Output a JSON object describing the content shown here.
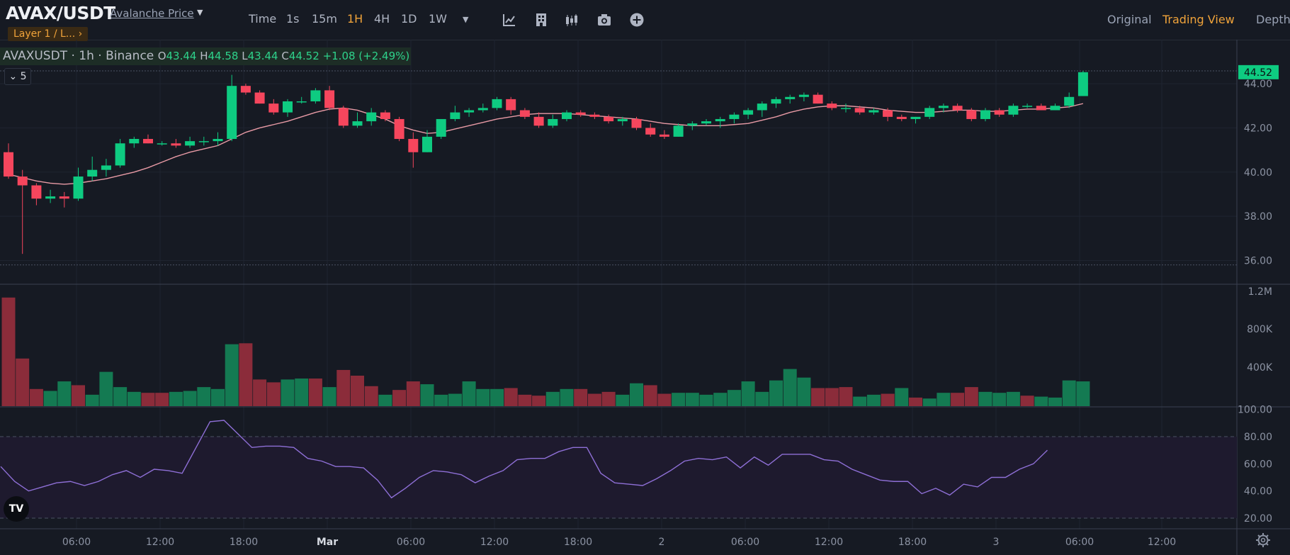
{
  "header": {
    "pair": "AVAX/USDT",
    "price_link": "Avalanche Price",
    "tag": "Layer 1 / L...",
    "tag_chevron": "›",
    "timeframes": [
      "Time",
      "1s",
      "15m",
      "1H",
      "4H",
      "1D",
      "1W"
    ],
    "active_timeframe": "1H",
    "tools": [
      "indicator-icon",
      "template-icon",
      "candle-style-icon",
      "camera-icon",
      "add-circle-icon"
    ],
    "views": [
      "Original",
      "Trading View",
      "Depth"
    ],
    "active_view": "Trading View"
  },
  "legend": {
    "symbol": "AVAXUSDT",
    "interval": "1h",
    "exchange": "Binance",
    "open_label": "O",
    "open": "43.44",
    "high_label": "H",
    "high": "44.58",
    "low_label": "L",
    "low": "43.44",
    "close_label": "C",
    "close": "44.52",
    "change": "+1.08 (+2.49%)",
    "indicator_count": "5"
  },
  "colors": {
    "up": "#0ecb81",
    "down": "#f6465d",
    "up_volume": "#147a52",
    "down_volume": "#8b2c3a",
    "rsi": "#8e6fd6",
    "ma": "#e89aa5",
    "accent": "#f0a33a"
  },
  "chart_data": {
    "type": "candlestick",
    "symbol": "AVAXUSDT",
    "last_price": "44.52",
    "price_axis": [
      "44.00",
      "42.00",
      "40.00",
      "38.00",
      "36.00"
    ],
    "volume_axis": [
      "1.2M",
      "800K",
      "400K"
    ],
    "rsi_axis": [
      "100.00",
      "80.00",
      "60.00",
      "40.00",
      "20.00"
    ],
    "time_axis": [
      "06:00",
      "12:00",
      "18:00",
      "Mar",
      "06:00",
      "12:00",
      "18:00",
      "2",
      "06:00",
      "12:00",
      "18:00",
      "3",
      "06:00",
      "12:00"
    ],
    "ylim": [
      35.6,
      44.9
    ],
    "candles": [
      [
        40.9,
        41.3,
        39.7,
        39.8
      ],
      [
        39.8,
        40.1,
        36.3,
        39.4
      ],
      [
        39.4,
        39.5,
        38.5,
        38.8
      ],
      [
        38.8,
        39.2,
        38.6,
        38.9
      ],
      [
        38.9,
        39.1,
        38.4,
        38.8
      ],
      [
        38.8,
        40.2,
        38.7,
        39.8
      ],
      [
        39.8,
        40.7,
        39.6,
        40.1
      ],
      [
        40.1,
        40.6,
        39.8,
        40.3
      ],
      [
        40.3,
        41.5,
        40.2,
        41.3
      ],
      [
        41.3,
        41.6,
        41.1,
        41.5
      ],
      [
        41.5,
        41.7,
        41.3,
        41.3
      ],
      [
        41.3,
        41.4,
        41.2,
        41.3
      ],
      [
        41.3,
        41.5,
        41.1,
        41.2
      ],
      [
        41.2,
        41.6,
        41.1,
        41.4
      ],
      [
        41.4,
        41.6,
        41.2,
        41.4
      ],
      [
        41.4,
        41.8,
        41.2,
        41.5
      ],
      [
        41.5,
        44.4,
        41.4,
        43.9
      ],
      [
        43.9,
        44.0,
        43.5,
        43.6
      ],
      [
        43.6,
        43.7,
        43.1,
        43.1
      ],
      [
        43.1,
        43.3,
        42.6,
        42.7
      ],
      [
        42.7,
        43.3,
        42.5,
        43.2
      ],
      [
        43.2,
        43.4,
        43.1,
        43.2
      ],
      [
        43.2,
        43.8,
        43.1,
        43.7
      ],
      [
        43.7,
        43.9,
        42.8,
        42.9
      ],
      [
        42.9,
        43.0,
        42.0,
        42.1
      ],
      [
        42.1,
        42.7,
        42.0,
        42.3
      ],
      [
        42.3,
        42.9,
        42.1,
        42.7
      ],
      [
        42.7,
        42.8,
        42.3,
        42.4
      ],
      [
        42.4,
        42.5,
        41.4,
        41.5
      ],
      [
        41.5,
        41.8,
        40.2,
        40.9
      ],
      [
        40.9,
        41.9,
        40.9,
        41.6
      ],
      [
        41.6,
        42.4,
        41.5,
        42.4
      ],
      [
        42.4,
        43.0,
        42.3,
        42.7
      ],
      [
        42.7,
        42.9,
        42.5,
        42.8
      ],
      [
        42.8,
        43.1,
        42.7,
        42.9
      ],
      [
        42.9,
        43.4,
        42.8,
        43.3
      ],
      [
        43.3,
        43.4,
        42.6,
        42.8
      ],
      [
        42.8,
        42.9,
        42.4,
        42.5
      ],
      [
        42.5,
        42.7,
        42.0,
        42.1
      ],
      [
        42.1,
        42.6,
        42.0,
        42.4
      ],
      [
        42.4,
        42.8,
        42.3,
        42.7
      ],
      [
        42.7,
        42.8,
        42.5,
        42.6
      ],
      [
        42.6,
        42.7,
        42.4,
        42.5
      ],
      [
        42.5,
        42.6,
        42.2,
        42.3
      ],
      [
        42.3,
        42.5,
        42.1,
        42.4
      ],
      [
        42.4,
        42.5,
        41.9,
        42.0
      ],
      [
        42.0,
        42.2,
        41.6,
        41.7
      ],
      [
        41.7,
        41.9,
        41.5,
        41.6
      ],
      [
        41.6,
        42.2,
        41.6,
        42.1
      ],
      [
        42.1,
        42.3,
        41.9,
        42.2
      ],
      [
        42.2,
        42.4,
        42.1,
        42.3
      ],
      [
        42.3,
        42.5,
        42.0,
        42.4
      ],
      [
        42.4,
        42.7,
        42.2,
        42.6
      ],
      [
        42.6,
        42.9,
        42.4,
        42.8
      ],
      [
        42.8,
        43.2,
        42.5,
        43.1
      ],
      [
        43.1,
        43.4,
        42.9,
        43.3
      ],
      [
        43.3,
        43.5,
        43.1,
        43.4
      ],
      [
        43.4,
        43.6,
        43.2,
        43.5
      ],
      [
        43.5,
        43.6,
        43.1,
        43.1
      ],
      [
        43.1,
        43.2,
        42.8,
        42.9
      ],
      [
        42.9,
        43.1,
        42.7,
        42.9
      ],
      [
        42.9,
        43.0,
        42.6,
        42.7
      ],
      [
        42.7,
        42.9,
        42.6,
        42.8
      ],
      [
        42.8,
        42.9,
        42.3,
        42.5
      ],
      [
        42.5,
        42.6,
        42.3,
        42.4
      ],
      [
        42.4,
        42.5,
        42.2,
        42.5
      ],
      [
        42.5,
        43.0,
        42.4,
        42.9
      ],
      [
        42.9,
        43.1,
        42.7,
        43.0
      ],
      [
        43.0,
        43.1,
        42.7,
        42.8
      ],
      [
        42.8,
        42.9,
        42.3,
        42.4
      ],
      [
        42.4,
        42.9,
        42.3,
        42.8
      ],
      [
        42.8,
        42.9,
        42.5,
        42.6
      ],
      [
        42.6,
        43.1,
        42.5,
        43.0
      ],
      [
        43.0,
        43.1,
        42.9,
        43.0
      ],
      [
        43.0,
        43.1,
        42.8,
        42.8
      ],
      [
        42.8,
        43.1,
        42.8,
        43.0
      ],
      [
        43.0,
        43.6,
        42.9,
        43.4
      ],
      [
        43.44,
        44.58,
        43.44,
        44.52
      ]
    ],
    "ma_values": [
      39.9,
      39.75,
      39.6,
      39.5,
      39.45,
      39.5,
      39.6,
      39.7,
      39.85,
      40.0,
      40.2,
      40.45,
      40.7,
      40.9,
      41.05,
      41.2,
      41.5,
      41.8,
      42.0,
      42.15,
      42.3,
      42.5,
      42.7,
      42.85,
      42.9,
      42.8,
      42.6,
      42.4,
      42.1,
      41.9,
      41.75,
      41.8,
      41.95,
      42.1,
      42.25,
      42.4,
      42.5,
      42.6,
      42.65,
      42.65,
      42.65,
      42.6,
      42.55,
      42.5,
      42.45,
      42.4,
      42.3,
      42.2,
      42.15,
      42.1,
      42.1,
      42.1,
      42.15,
      42.2,
      42.35,
      42.5,
      42.7,
      42.85,
      42.95,
      43.0,
      43.0,
      42.95,
      42.9,
      42.8,
      42.75,
      42.7,
      42.7,
      42.75,
      42.8,
      42.8,
      42.75,
      42.75,
      42.8,
      42.85,
      42.85,
      42.9,
      42.95,
      43.1
    ],
    "volume_up": [
      false,
      false,
      false,
      true,
      true,
      false,
      true,
      true,
      true,
      true,
      false,
      false,
      true,
      true,
      true,
      true,
      true,
      false,
      false,
      false,
      true,
      true,
      false,
      true,
      false,
      false,
      false,
      true,
      false,
      false,
      true,
      true,
      true,
      true,
      true,
      true,
      false,
      false,
      false,
      true,
      true,
      false,
      false,
      false,
      true,
      true,
      false,
      false,
      true,
      true,
      true,
      true,
      true,
      true,
      true,
      true,
      true,
      true,
      false,
      false,
      false,
      true,
      true,
      false,
      true,
      false,
      true,
      true,
      false,
      false,
      true,
      true,
      true,
      false,
      true,
      true,
      true,
      true
    ],
    "volumes": [
      1.14,
      0.5,
      0.18,
      0.16,
      0.26,
      0.22,
      0.12,
      0.36,
      0.2,
      0.15,
      0.14,
      0.14,
      0.15,
      0.16,
      0.2,
      0.18,
      0.65,
      0.66,
      0.28,
      0.25,
      0.28,
      0.29,
      0.29,
      0.2,
      0.38,
      0.32,
      0.21,
      0.12,
      0.17,
      0.26,
      0.23,
      0.12,
      0.13,
      0.26,
      0.18,
      0.18,
      0.19,
      0.12,
      0.11,
      0.15,
      0.18,
      0.18,
      0.13,
      0.15,
      0.12,
      0.24,
      0.22,
      0.13,
      0.14,
      0.14,
      0.12,
      0.14,
      0.17,
      0.26,
      0.15,
      0.27,
      0.39,
      0.3,
      0.19,
      0.19,
      0.2,
      0.1,
      0.12,
      0.13,
      0.19,
      0.09,
      0.08,
      0.14,
      0.14,
      0.2,
      0.15,
      0.14,
      0.15,
      0.11,
      0.1,
      0.09,
      0.27,
      0.26
    ],
    "rsi": [
      58,
      47,
      40,
      43,
      46,
      47,
      44,
      47,
      52,
      55,
      50,
      56,
      55,
      53,
      72,
      91,
      92,
      82,
      72,
      73,
      73,
      72,
      64,
      62,
      58,
      58,
      57,
      48,
      35,
      42,
      50,
      55,
      54,
      52,
      46,
      51,
      55,
      63,
      64,
      64,
      69,
      72,
      72,
      53,
      46,
      45,
      44,
      49,
      55,
      62,
      64,
      63,
      65,
      57,
      65,
      59,
      67,
      67,
      67,
      63,
      62,
      56,
      52,
      48,
      47,
      47,
      38,
      42,
      37,
      45,
      43,
      50,
      50,
      56,
      60,
      70
    ]
  }
}
